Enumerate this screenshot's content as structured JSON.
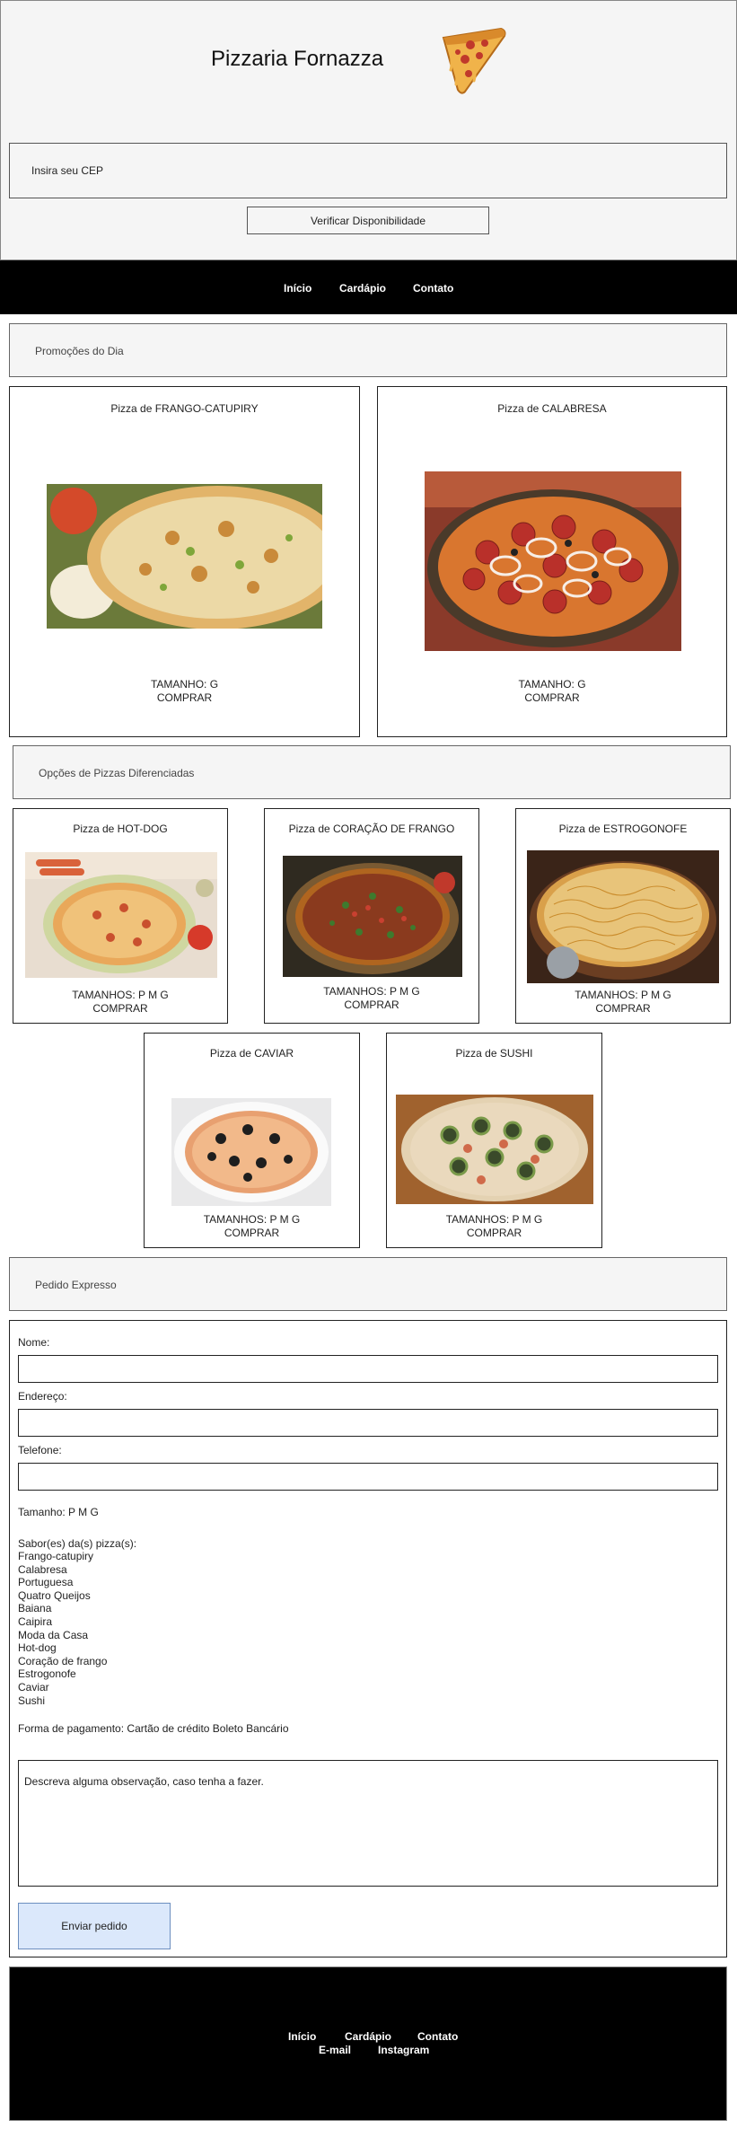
{
  "header": {
    "title": "Pizzaria Fornazza",
    "cep_placeholder": "Insira seu CEP",
    "check_button": "Verificar Disponibilidade"
  },
  "nav": {
    "items": [
      "Início",
      "Cardápio",
      "Contato"
    ]
  },
  "promos": {
    "banner": "Promoções do Dia",
    "cards": [
      {
        "title": "Pizza de FRANGO-CATUPIRY",
        "size": "TAMANHO: G",
        "buy": "COMPRAR"
      },
      {
        "title": "Pizza de CALABRESA",
        "size": "TAMANHO: G",
        "buy": "COMPRAR"
      }
    ]
  },
  "special": {
    "banner": "Opções de Pizzas Diferenciadas",
    "cards": [
      {
        "title": "Pizza de HOT-DOG",
        "size": "TAMANHOS: P M G",
        "buy": "COMPRAR"
      },
      {
        "title": "Pizza de CORAÇÃO DE FRANGO",
        "size": "TAMANHOS: P M G",
        "buy": "COMPRAR"
      },
      {
        "title": "Pizza de ESTROGONOFE",
        "size": "TAMANHOS: P M G",
        "buy": "COMPRAR"
      },
      {
        "title": "Pizza de CAVIAR",
        "size": "TAMANHOS: P M G",
        "buy": "COMPRAR"
      },
      {
        "title": "Pizza de SUSHI",
        "size": "TAMANHOS: P M G",
        "buy": "COMPRAR"
      }
    ]
  },
  "order": {
    "banner": "Pedido Expresso",
    "name_label": "Nome:",
    "address_label": "Endereço:",
    "phone_label": "Telefone:",
    "size_line": "Tamanho: P M G",
    "flavors_label": "Sabor(es) da(s) pizza(s):",
    "flavors": [
      "Frango-catupiry",
      "Calabresa",
      "Portuguesa",
      "Quatro Queijos",
      "Baiana",
      "Caipira",
      "Moda da Casa",
      "Hot-dog",
      "Coração de frango",
      "Estrogonofe",
      "Caviar",
      "Sushi"
    ],
    "payment_line": "Forma de pagamento: Cartão de crédito Boleto Bancário",
    "notes_placeholder": "Descreva alguma observação, caso tenha a fazer.",
    "submit": "Enviar pedido"
  },
  "footer": {
    "items": [
      "Início",
      "Cardápio",
      "Contato"
    ],
    "social": [
      "E-mail",
      "Instagram"
    ]
  }
}
